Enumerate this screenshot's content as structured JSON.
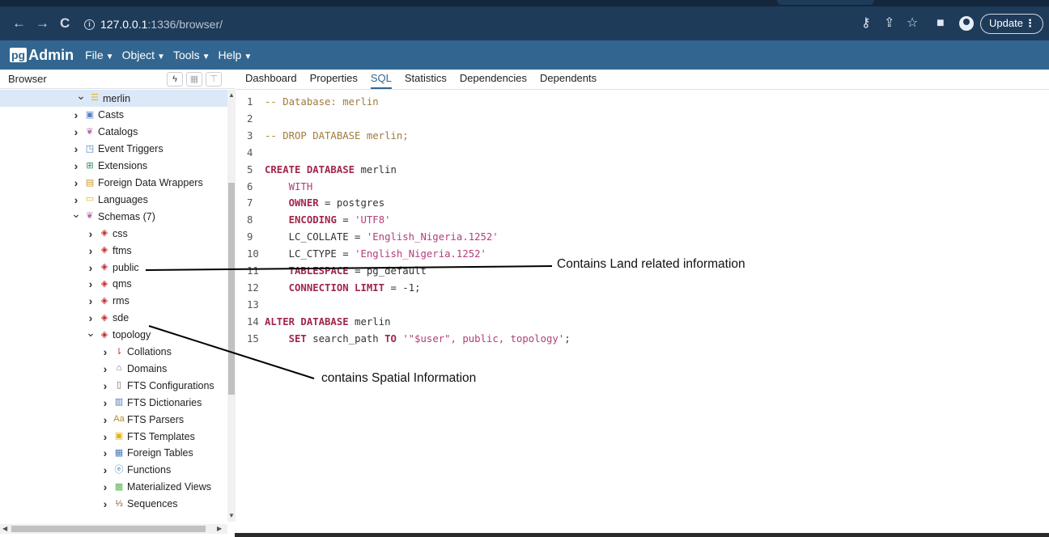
{
  "browser": {
    "url_host": "127.0.0.1",
    "url_path": ":1336/browser/",
    "update_label": "Update"
  },
  "app": {
    "logo_pg": "pg",
    "logo_admin": "Admin",
    "menu": [
      "File",
      "Object",
      "Tools",
      "Help"
    ]
  },
  "browser_panel": {
    "title": "Browser",
    "tree": [
      {
        "label": "merlin",
        "level": 0,
        "expanded": true,
        "icon": "database-icon",
        "selected": true
      },
      {
        "label": "Casts",
        "level": 1,
        "expanded": false,
        "icon": "casts-icon"
      },
      {
        "label": "Catalogs",
        "level": 1,
        "expanded": false,
        "icon": "catalogs-icon"
      },
      {
        "label": "Event Triggers",
        "level": 1,
        "expanded": false,
        "icon": "event-triggers-icon"
      },
      {
        "label": "Extensions",
        "level": 1,
        "expanded": false,
        "icon": "extensions-icon"
      },
      {
        "label": "Foreign Data Wrappers",
        "level": 1,
        "expanded": false,
        "icon": "fdw-icon"
      },
      {
        "label": "Languages",
        "level": 1,
        "expanded": false,
        "icon": "languages-icon"
      },
      {
        "label": "Schemas (7)",
        "level": 1,
        "expanded": true,
        "icon": "schemas-icon"
      },
      {
        "label": "css",
        "level": 2,
        "expanded": false,
        "icon": "schema-icon"
      },
      {
        "label": "ftms",
        "level": 2,
        "expanded": false,
        "icon": "schema-icon"
      },
      {
        "label": "public",
        "level": 2,
        "expanded": false,
        "icon": "schema-icon"
      },
      {
        "label": "qms",
        "level": 2,
        "expanded": false,
        "icon": "schema-icon"
      },
      {
        "label": "rms",
        "level": 2,
        "expanded": false,
        "icon": "schema-icon"
      },
      {
        "label": "sde",
        "level": 2,
        "expanded": false,
        "icon": "schema-icon"
      },
      {
        "label": "topology",
        "level": 2,
        "expanded": true,
        "icon": "schema-icon"
      },
      {
        "label": "Collations",
        "level": 3,
        "expanded": false,
        "icon": "collations-icon"
      },
      {
        "label": "Domains",
        "level": 3,
        "expanded": false,
        "icon": "domains-icon"
      },
      {
        "label": "FTS Configurations",
        "level": 3,
        "expanded": false,
        "icon": "fts-config-icon"
      },
      {
        "label": "FTS Dictionaries",
        "level": 3,
        "expanded": false,
        "icon": "fts-dict-icon"
      },
      {
        "label": "FTS Parsers",
        "level": 3,
        "expanded": false,
        "icon": "fts-parser-icon"
      },
      {
        "label": "FTS Templates",
        "level": 3,
        "expanded": false,
        "icon": "fts-template-icon"
      },
      {
        "label": "Foreign Tables",
        "level": 3,
        "expanded": false,
        "icon": "foreign-tables-icon"
      },
      {
        "label": "Functions",
        "level": 3,
        "expanded": false,
        "icon": "functions-icon"
      },
      {
        "label": "Materialized Views",
        "level": 3,
        "expanded": false,
        "icon": "mviews-icon"
      },
      {
        "label": "Sequences",
        "level": 3,
        "expanded": false,
        "icon": "sequences-icon"
      }
    ]
  },
  "tabs": [
    "Dashboard",
    "Properties",
    "SQL",
    "Statistics",
    "Dependencies",
    "Dependents"
  ],
  "active_tab": "SQL",
  "sql": [
    {
      "n": "1",
      "parts": [
        [
          "cmt",
          "-- Database: merlin"
        ]
      ]
    },
    {
      "n": "2",
      "parts": []
    },
    {
      "n": "3",
      "parts": [
        [
          "cmt",
          "-- DROP DATABASE merlin;"
        ]
      ]
    },
    {
      "n": "4",
      "parts": []
    },
    {
      "n": "5",
      "parts": [
        [
          "kw",
          "CREATE DATABASE"
        ],
        [
          "plain",
          " merlin"
        ]
      ]
    },
    {
      "n": "6",
      "parts": [
        [
          "plain",
          "    "
        ],
        [
          "str",
          "WITH"
        ]
      ]
    },
    {
      "n": "7",
      "parts": [
        [
          "plain",
          "    "
        ],
        [
          "kw",
          "OWNER"
        ],
        [
          "plain",
          " = postgres"
        ]
      ]
    },
    {
      "n": "8",
      "parts": [
        [
          "plain",
          "    "
        ],
        [
          "kw",
          "ENCODING"
        ],
        [
          "plain",
          " = "
        ],
        [
          "str",
          "'UTF8'"
        ]
      ]
    },
    {
      "n": "9",
      "parts": [
        [
          "plain",
          "    LC_COLLATE = "
        ],
        [
          "str",
          "'English_Nigeria.1252'"
        ]
      ]
    },
    {
      "n": "10",
      "parts": [
        [
          "plain",
          "    LC_CTYPE = "
        ],
        [
          "str",
          "'English_Nigeria.1252'"
        ]
      ]
    },
    {
      "n": "11",
      "parts": [
        [
          "plain",
          "    "
        ],
        [
          "kw",
          "TABLESPACE"
        ],
        [
          "plain",
          " = pg_default"
        ]
      ]
    },
    {
      "n": "12",
      "parts": [
        [
          "plain",
          "    "
        ],
        [
          "kw",
          "CONNECTION LIMIT"
        ],
        [
          "plain",
          " = -1;"
        ]
      ]
    },
    {
      "n": "13",
      "parts": []
    },
    {
      "n": "14",
      "parts": [
        [
          "kw",
          "ALTER DATABASE"
        ],
        [
          "plain",
          " merlin"
        ]
      ]
    },
    {
      "n": "15",
      "parts": [
        [
          "plain",
          "    "
        ],
        [
          "kw",
          "SET"
        ],
        [
          "plain",
          " search_path "
        ],
        [
          "kw",
          "TO"
        ],
        [
          "plain",
          " "
        ],
        [
          "str",
          "'\"$user\", public, topology'"
        ],
        [
          "plain",
          ";"
        ]
      ]
    }
  ],
  "annotations": {
    "land": "Contains Land related information",
    "spatial": "contains Spatial Information"
  }
}
